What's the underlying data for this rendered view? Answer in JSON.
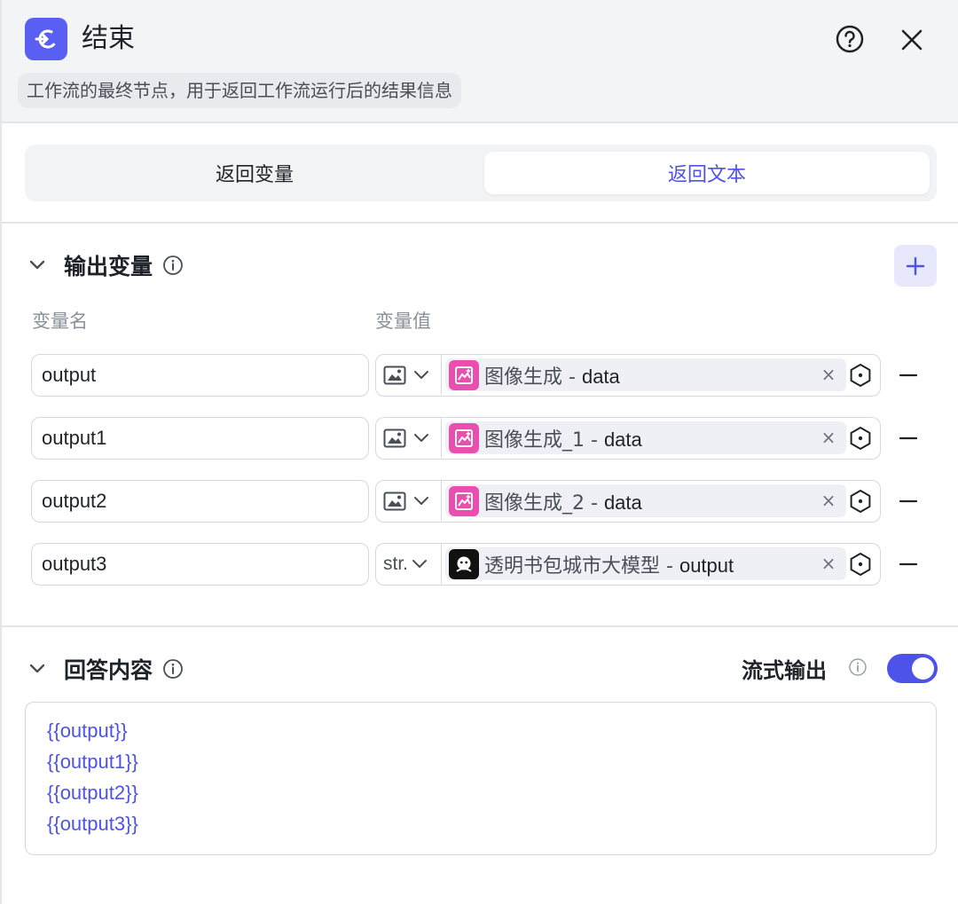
{
  "node": {
    "title": "结束",
    "description": "工作流的最终节点，用于返回工作流运行后的结果信息",
    "accent_color": "#5a5ff4"
  },
  "header_actions": {
    "help_icon": "question-circle-icon",
    "close_icon": "close-icon"
  },
  "tabs": [
    {
      "label": "返回变量",
      "active": false
    },
    {
      "label": "返回文本",
      "active": true
    }
  ],
  "output_section": {
    "title": "输出变量",
    "col_name": "变量名",
    "col_value": "变量值",
    "rows": [
      {
        "name": "output",
        "type": "image",
        "type_label": "",
        "ref_node": "图像生成",
        "ref_sep": " - ",
        "ref_field": "data",
        "ref_icon": "image-gen-icon"
      },
      {
        "name": "output1",
        "type": "image",
        "type_label": "",
        "ref_node": "图像生成_1",
        "ref_sep": " - ",
        "ref_field": "data",
        "ref_icon": "image-gen-icon"
      },
      {
        "name": "output2",
        "type": "image",
        "type_label": "",
        "ref_node": "图像生成_2",
        "ref_sep": " - ",
        "ref_field": "data",
        "ref_icon": "image-gen-icon"
      },
      {
        "name": "output3",
        "type": "string",
        "type_label": "str.",
        "ref_node": "透明书包城市大模型",
        "ref_sep": " - ",
        "ref_field": "output",
        "ref_icon": "llm-model-icon"
      }
    ]
  },
  "answer_section": {
    "title": "回答内容",
    "stream_label": "流式输出",
    "stream_enabled": true,
    "lines": [
      "{{output}}",
      "{{output1}}",
      "{{output2}}",
      "{{output3}}"
    ]
  },
  "colors": {
    "primary": "#4d53e8",
    "pink_tag": "#e94fae"
  }
}
